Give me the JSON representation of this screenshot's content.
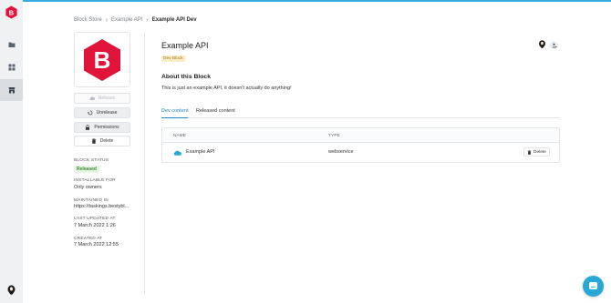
{
  "breadcrumb": [
    "Block Store",
    "Example API",
    "Example API Dev"
  ],
  "block": {
    "title": "Example API",
    "type_badge": "Dev Block",
    "about_title": "About this Block",
    "about_text": "This is just an example API, it doesn't actually do anything!"
  },
  "actions": {
    "release": "Release",
    "unrelease": "Unrelease",
    "permissions": "Permissions",
    "delete": "Delete"
  },
  "meta": {
    "status_label": "BLOCK STATUS",
    "status_value": "Released",
    "installable_label": "INSTALLABLE FOR",
    "installable_value": "Only owners",
    "maintained_label": "MAINTAINED IN",
    "maintained_value": "https://taskings.bestybl...",
    "updated_label": "LAST UPDATED AT",
    "updated_value": "7 March 2022 1:26",
    "created_label": "CREATED AT",
    "created_value": "7 March 2022 12:55"
  },
  "tabs": [
    "Dev content",
    "Released content"
  ],
  "table": {
    "headers": [
      "NAME",
      "TYPE"
    ],
    "rows": [
      {
        "name": "Example API",
        "type": "webservice",
        "action": "Delete",
        "icon": "cloud-icon"
      }
    ]
  },
  "colors": {
    "brand": "#e0133b",
    "accent": "#1f86c8",
    "chat": "#29a8d8"
  }
}
